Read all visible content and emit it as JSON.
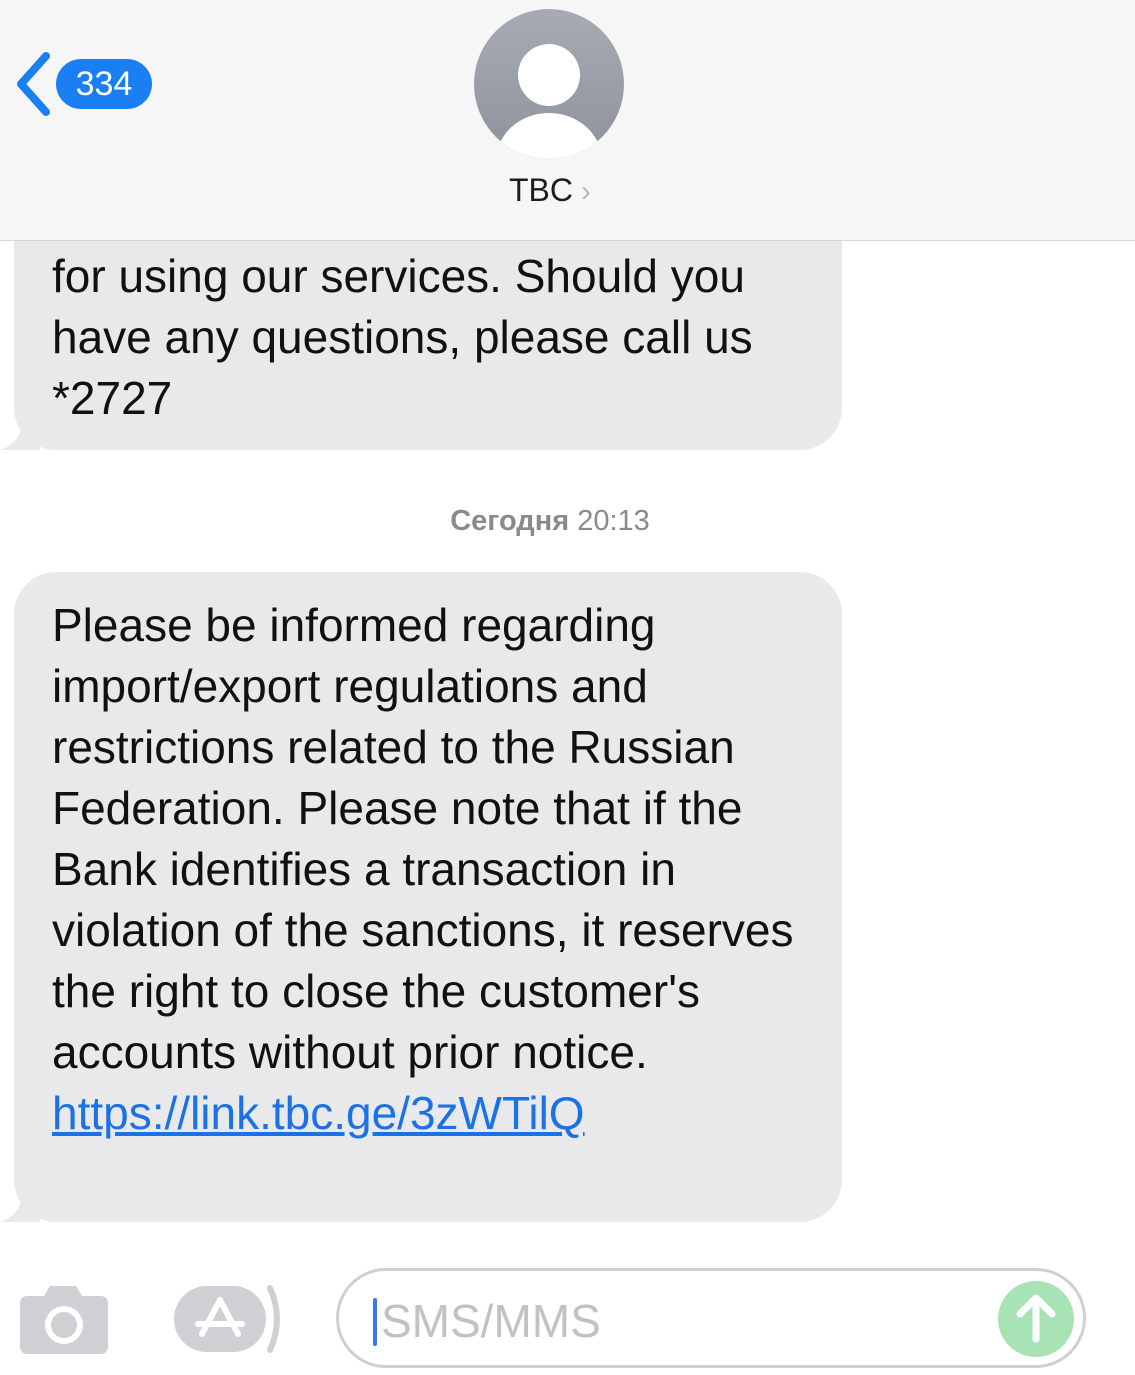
{
  "header": {
    "back_count": "334",
    "contact_name": "TBC",
    "chevron": "›"
  },
  "messages": {
    "first": {
      "text": "for using our services. Should you have any questions, please call us *2727"
    },
    "timestamp": {
      "day": "Сегодня",
      "time": "20:13"
    },
    "second": {
      "text": "Please be informed regarding import/export regulations and restrictions related to the Russian Federation. Please note that if the Bank identifies a transaction in violation of the sanctions, it reserves the right to close the customer's accounts without prior notice.",
      "link": "https://link.tbc.ge/3zWTilQ"
    }
  },
  "input_bar": {
    "placeholder": "SMS/MMS"
  },
  "colors": {
    "accent": "#1a7ff2",
    "bubble": "#e9e9eb",
    "send_disabled": "#a7e3b4"
  },
  "icons": [
    "chevron-left-icon",
    "person-icon",
    "camera-icon",
    "app-store-icon",
    "arrow-up-icon"
  ]
}
